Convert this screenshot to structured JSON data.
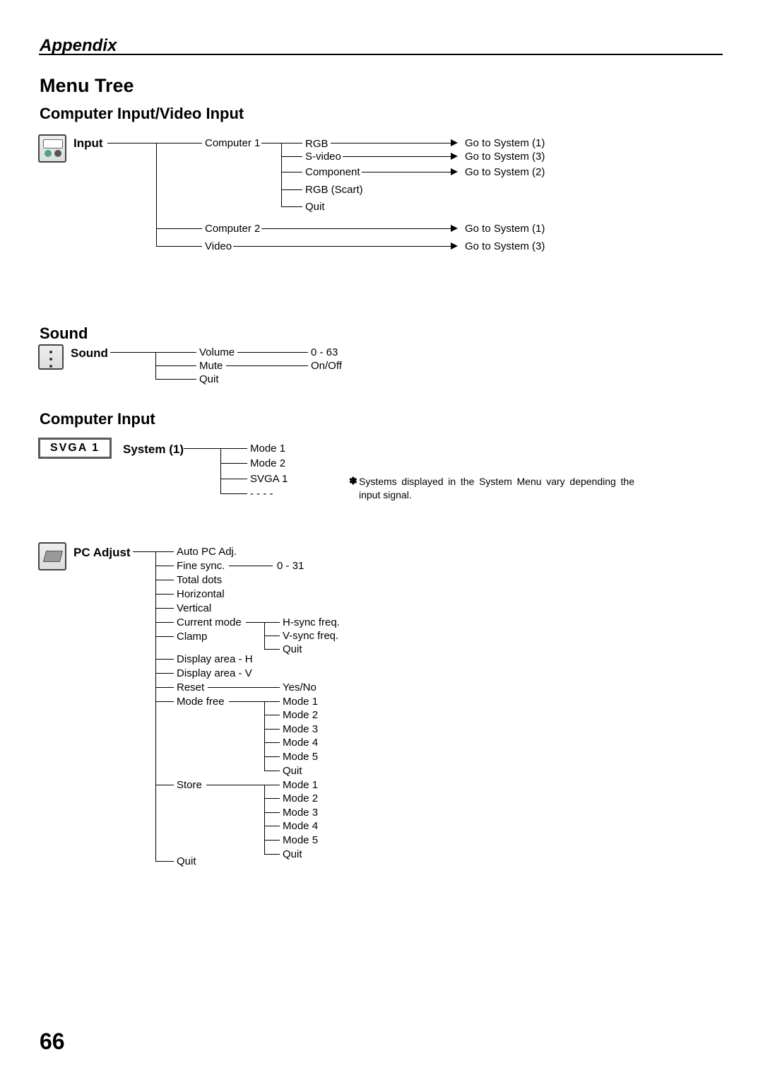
{
  "page": {
    "appendix": "Appendix",
    "title": "Menu Tree",
    "number": "66"
  },
  "sections": {
    "civ": "Computer Input/Video Input",
    "sound": "Sound",
    "ci": "Computer Input"
  },
  "input": {
    "label": "Input",
    "computer1": "Computer 1",
    "computer2": "Computer 2",
    "video": "Video",
    "rgb": "RGB",
    "svideo": "S-video",
    "component": "Component",
    "rgb_scart": "RGB (Scart)",
    "quit": "Quit",
    "goto1": "Go to System (1)",
    "goto2": "Go to System (2)",
    "goto3": "Go to System (3)"
  },
  "sound": {
    "label": "Sound",
    "volume": "Volume",
    "mute": "Mute",
    "quit": "Quit",
    "vol_range": "0 - 63",
    "onoff": "On/Off"
  },
  "system": {
    "label": "System (1)",
    "mode1": "Mode 1",
    "mode2": "Mode 2",
    "svga1": "SVGA 1",
    "dashes": "- - - -",
    "box": "SVGA  1",
    "note_star": "✽",
    "note": "Systems displayed in the System Menu vary depending the input signal."
  },
  "pcadjust": {
    "label": "PC Adjust",
    "auto": "Auto PC Adj.",
    "fine": "Fine sync.",
    "fine_range": "0 - 31",
    "total": "Total dots",
    "horiz": "Horizontal",
    "vert": "Vertical",
    "current": "Current mode",
    "hsync": "H-sync freq.",
    "vsync": "V-sync freq.",
    "quit": "Quit",
    "clamp": "Clamp",
    "dah": "Display area - H",
    "dav": "Display area - V",
    "reset": "Reset",
    "yesno": "Yes/No",
    "modefree": "Mode free",
    "store": "Store",
    "m1": "Mode 1",
    "m2": "Mode 2",
    "m3": "Mode 3",
    "m4": "Mode 4",
    "m5": "Mode 5"
  }
}
